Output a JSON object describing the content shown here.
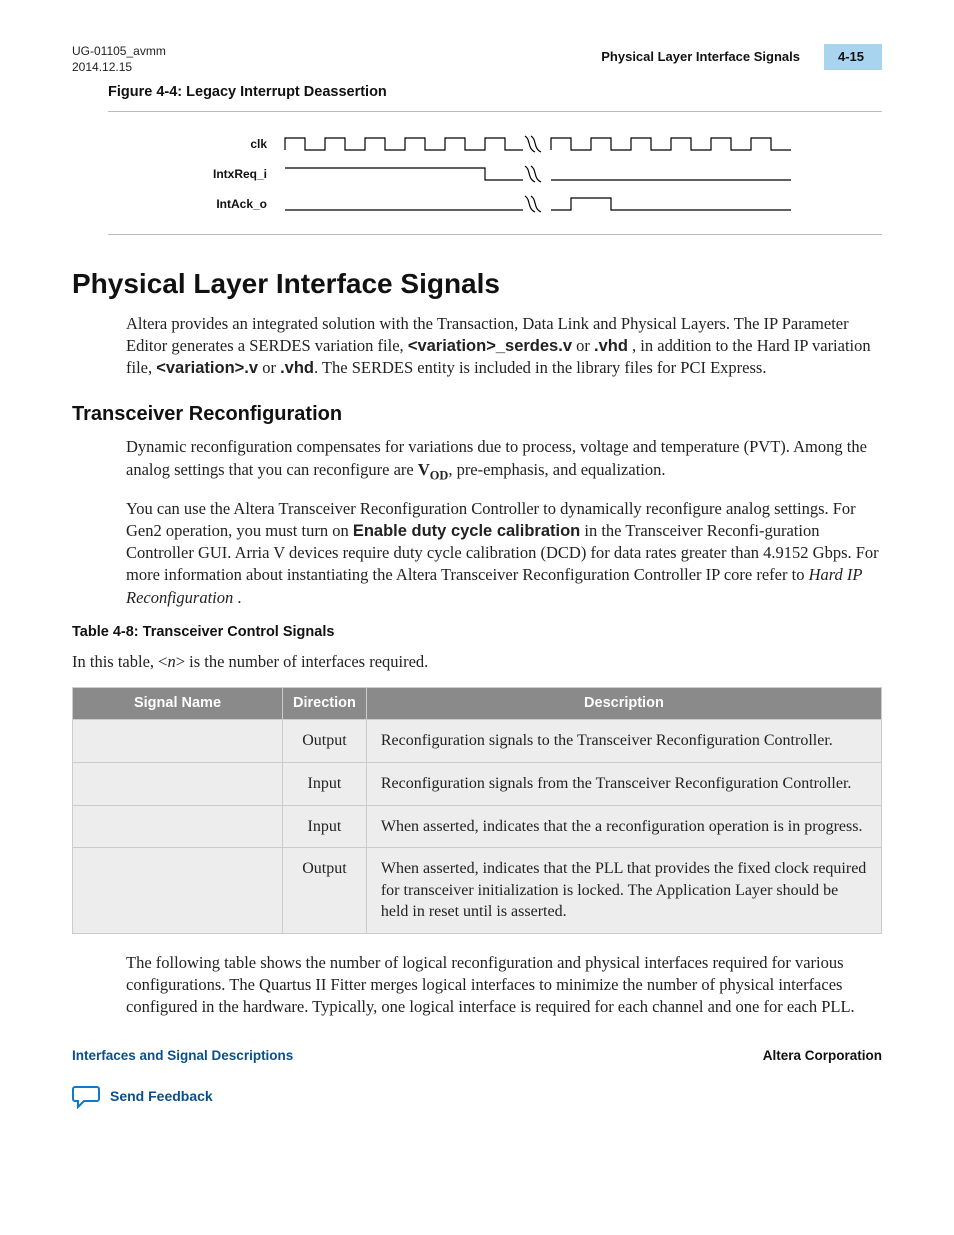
{
  "header": {
    "doc_id": "UG-01105_avmm",
    "date": "2014.12.15",
    "section_title": "Physical Layer Interface Signals",
    "page_num": "4-15"
  },
  "figure": {
    "caption": "Figure 4-4: Legacy Interrupt Deassertion",
    "signals": {
      "clk": "clk",
      "intxreq": "IntxReq_i",
      "intack": "IntAck_o"
    }
  },
  "section_heading": "Physical Layer Interface Signals",
  "intro_para_parts": {
    "p1": "Altera provides an integrated solution with the Transaction, Data Link and Physical Layers. The IP Parameter Editor generates a SERDES variation file, ",
    "file1": "<variation>_serdes.v",
    "p2": " or ",
    "file2": ".vhd",
    "p3": " , in addition to the Hard IP variation file, ",
    "file3": "<variation>.v",
    "p4": " or ",
    "file4": ".vhd",
    "p5": ". The SERDES entity is included in the library files for PCI Express."
  },
  "subsection_heading": "Transceiver Reconfiguration",
  "reconfig_para1_parts": {
    "p1": "Dynamic reconfiguration compensates for variations due to process, voltage and temperature (PVT). Among the analog settings that you can reconfigure are ",
    "vod": "V",
    "vod_sub": "OD",
    "p2": ", pre-emphasis, and equalization."
  },
  "reconfig_para2_parts": {
    "p1": "You can use the Altera Transceiver Reconfiguration Controller to dynamically reconfigure analog settings. For Gen2 operation, you must turn on ",
    "bold": "Enable duty cycle calibration",
    "p2": " in the Transceiver Reconfi‐guration Controller GUI. Arria V devices require duty cycle calibration (DCD) for data rates greater than 4.9152 Gbps. For more information about instantiating the Altera Transceiver Reconfiguration Controller IP core refer to ",
    "italic": "Hard IP Reconfiguration",
    "p3": " ."
  },
  "table": {
    "caption": "Table 4-8: Transceiver Control Signals",
    "intro_parts": {
      "p1": "In this table, <",
      "n": "n",
      "p2": "> is the number of interfaces required."
    },
    "headers": {
      "name": "Signal Name",
      "direction": "Direction",
      "description": "Description"
    },
    "rows": [
      {
        "name": "",
        "direction": "Output",
        "description": "Reconfiguration signals to the Transceiver Reconfiguration Controller."
      },
      {
        "name": "",
        "direction": "Input",
        "description": "Reconfiguration signals from the Transceiver Reconfiguration Controller."
      },
      {
        "name": "",
        "direction": "Input",
        "description": "When asserted, indicates that the a reconfiguration operation is in progress."
      },
      {
        "name": "",
        "direction": "Output",
        "description": "When asserted, indicates that the PLL that provides the fixed clock required for transceiver initialization is locked. The Application Layer should be held in reset until                                          is asserted."
      }
    ]
  },
  "closing_para": "The following table shows the number of logical reconfiguration and physical interfaces required for various configurations. The Quartus II Fitter merges logical interfaces to minimize the number of physical interfaces configured in the hardware. Typically, one logical interface is required for each channel and one for each PLL.",
  "footer": {
    "left": "Interfaces and Signal Descriptions",
    "right": "Altera Corporation",
    "feedback": "Send Feedback"
  }
}
